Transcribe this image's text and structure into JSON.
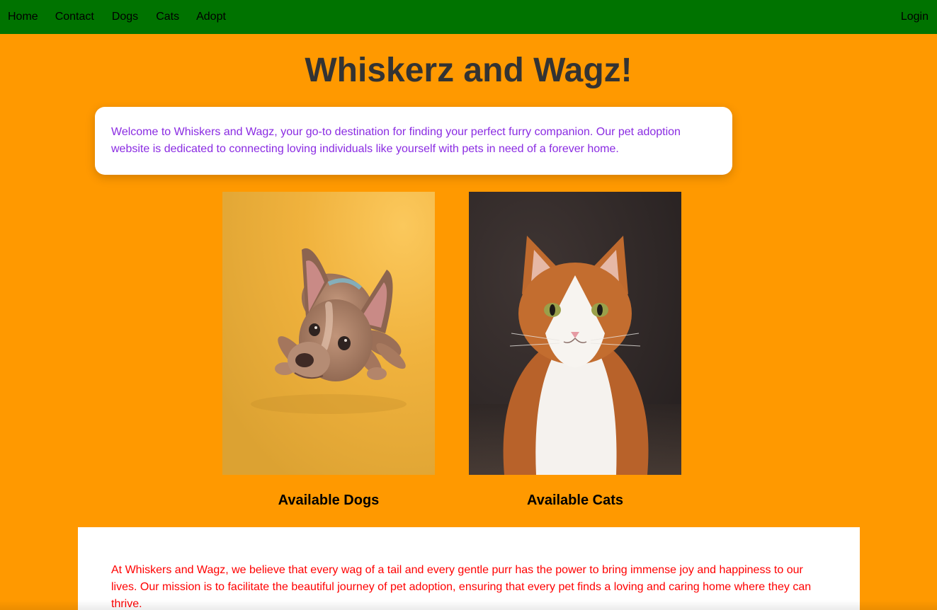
{
  "nav": {
    "links": [
      "Home",
      "Contact",
      "Dogs",
      "Cats",
      "Adopt"
    ],
    "login": "Login"
  },
  "header": {
    "title": "Whiskerz and Wagz!"
  },
  "welcome": {
    "text": "Welcome to Whiskers and Wagz, your go-to destination for finding your perfect furry companion. Our pet adoption website is dedicated to connecting loving individuals like yourself with pets in need of a forever home."
  },
  "pets": {
    "dogs_caption": "Available Dogs",
    "cats_caption": "Available Cats"
  },
  "mission": {
    "text": "At Whiskers and Wagz, we believe that every wag of a tail and every gentle purr has the power to bring immense joy and happiness to our lives. Our mission is to facilitate the beautiful journey of pet adoption, ensuring that every pet finds a loving and caring home where they can thrive."
  },
  "colors": {
    "page_background": "#ff9900",
    "navbar": "#007300",
    "title": "#333333",
    "welcome_text": "#8a2be2",
    "mission_text": "#ff0000"
  }
}
